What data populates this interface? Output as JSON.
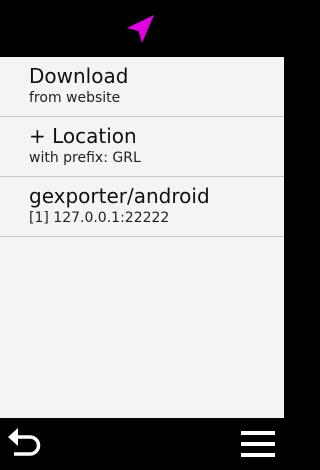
{
  "colors": {
    "background": "#000000",
    "list_background": "#f4f4f4",
    "divider": "#c9c9c9",
    "accent": "#e000e0"
  },
  "header": {
    "icon": "navigation-arrow-icon"
  },
  "list": {
    "items": [
      {
        "title": "Download",
        "subtitle": "from website"
      },
      {
        "title": "+ Location",
        "subtitle": "with prefix: GRL"
      },
      {
        "title": "gexporter/android",
        "subtitle": "[1] 127.0.0.1:22222"
      }
    ]
  },
  "footer": {
    "back_icon": "back-arrow-icon",
    "menu_icon": "hamburger-menu-icon"
  }
}
